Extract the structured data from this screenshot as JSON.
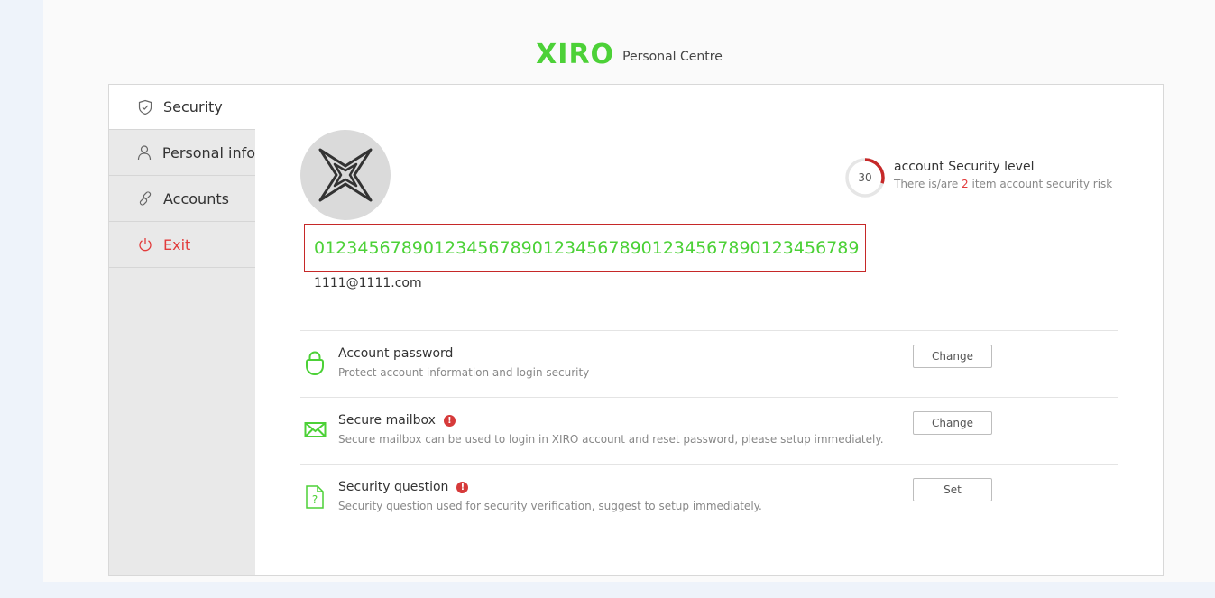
{
  "header": {
    "logo": "XIRO",
    "subtitle": "Personal Centre"
  },
  "sidebar": {
    "items": [
      {
        "label": "Security",
        "icon": "shield-icon",
        "active": true
      },
      {
        "label": "Personal info",
        "icon": "person-icon"
      },
      {
        "label": "Accounts",
        "icon": "link-icon"
      },
      {
        "label": "Exit",
        "icon": "power-icon"
      }
    ]
  },
  "profile": {
    "user_id": "01234567890123456789012345678901234567890123456789",
    "email": "1111@1111.com"
  },
  "security_level": {
    "score": "30",
    "score_fraction": 0.3,
    "title": "account Security level",
    "risk_prefix": "There is/are ",
    "risk_count": "2",
    "risk_suffix": " item account security risk"
  },
  "security_items": [
    {
      "title": "Account password",
      "desc": "Protect account information and login security",
      "button": "Change",
      "icon": "lock-icon",
      "alert": false
    },
    {
      "title": "Secure mailbox",
      "desc": "Secure mailbox can be used to login in XIRO account and reset password, please setup immediately.",
      "button": "Change",
      "icon": "mail-icon",
      "alert": true
    },
    {
      "title": "Security question",
      "desc": "Security question used for security verification, suggest to setup immediately.",
      "button": "Set",
      "icon": "question-doc-icon",
      "alert": true
    }
  ],
  "colors": {
    "brand": "#4cd137",
    "danger": "#e23b3b",
    "alert_badge": "#d63a3a"
  },
  "alert_mark": "!"
}
